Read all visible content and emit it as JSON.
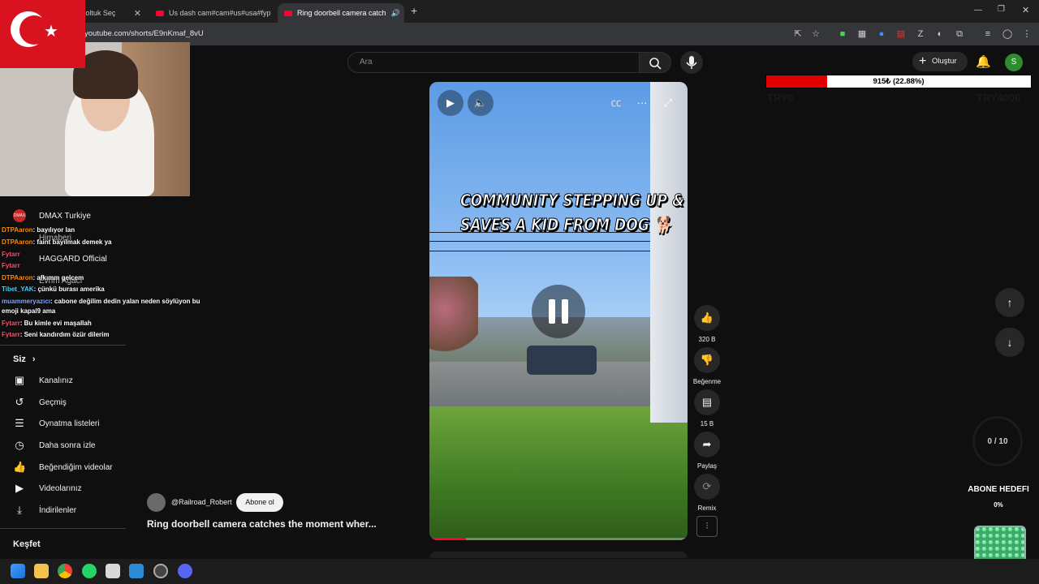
{
  "browser": {
    "tabs": [
      {
        "label": "...itası | Koltuk Seç",
        "active": false
      },
      {
        "label": "Us dash cam#cam#us#usa#fyp",
        "active": false
      },
      {
        "label": "Ring doorbell camera catch",
        "active": true
      }
    ],
    "new_tab": "+",
    "url": "youtube.com/shorts/E9nKmaf_8vU"
  },
  "header": {
    "search_placeholder": "Ara",
    "create_label": "Oluştur",
    "user_initial": "S"
  },
  "sidebar": {
    "subscriptions": [
      {
        "name": "DMAX Turkiye"
      },
      {
        "name": "Himaberi"
      },
      {
        "name": "HAGGARD Official"
      },
      {
        "name": "Evrim Ağacı"
      }
    ],
    "you_label": "Siz",
    "you_chevron": "›",
    "items": [
      {
        "label": "Kanalınız",
        "icon": "channel-icon"
      },
      {
        "label": "Geçmiş",
        "icon": "history-icon"
      },
      {
        "label": "Oynatma listeleri",
        "icon": "playlist-icon"
      },
      {
        "label": "Daha sonra izle",
        "icon": "clock-icon"
      },
      {
        "label": "Beğendiğim videolar",
        "icon": "thumbs-up-icon"
      },
      {
        "label": "Videolarınız",
        "icon": "video-icon"
      },
      {
        "label": "İndirilenler",
        "icon": "download-icon"
      }
    ],
    "explore_label": "Keşfet"
  },
  "chat": [
    {
      "name": "DTPAaron",
      "msg": ": bayılıyor lan"
    },
    {
      "name": "DTPAaron",
      "msg": ": faint bayılmak demek ya"
    },
    {
      "name": "Fytarr",
      "msg": ""
    },
    {
      "name": "Fytarr",
      "msg": ""
    },
    {
      "name": "DTPAaron",
      "msg": ": afkımm gelcem"
    },
    {
      "name": "Tibet_YAK",
      "msg": ": çünkü burası amerika"
    },
    {
      "name": "muammeryazıcı",
      "msg": ": cabone değilim dedin yalan neden söylüyon bu"
    },
    {
      "name": "",
      "msg": "emoji kapal9 ama"
    },
    {
      "name": "Fytarr",
      "msg": ": Bu kimle evi maşallah"
    },
    {
      "name": "Fytarr",
      "msg": ": Seni kandırdım özür dilerim"
    }
  ],
  "video": {
    "overlay_title_line1": "COMMUNITY STEPPING UP &",
    "overlay_title_line2": "SAVES A KID FROM DOG 🐕",
    "progress": 0.14,
    "channel": "@Railroad_Robert",
    "subscribe_label": "Abone ol",
    "caption": "Ring doorbell camera catches the moment wher..."
  },
  "actions": [
    {
      "label": "320 B",
      "icon": "thumbs-up-icon"
    },
    {
      "label": "Beğenme",
      "icon": "thumbs-down-icon"
    },
    {
      "label": "15 B",
      "icon": "comment-icon"
    },
    {
      "label": "Paylaş",
      "icon": "share-icon"
    },
    {
      "label": "Remix",
      "icon": "remix-icon"
    }
  ],
  "donation": {
    "text": "915₺ (22.88%)",
    "fraction": 0.2288,
    "min_label": "TRY0",
    "max_label": "TRY4000"
  },
  "goal": {
    "counter": "0 / 10",
    "title": "ABONE HEDEFI",
    "percent": "0%"
  },
  "colors": {
    "accent": "#ff0033",
    "background": "#0f0f0f",
    "donation_fill": "#e00000"
  }
}
